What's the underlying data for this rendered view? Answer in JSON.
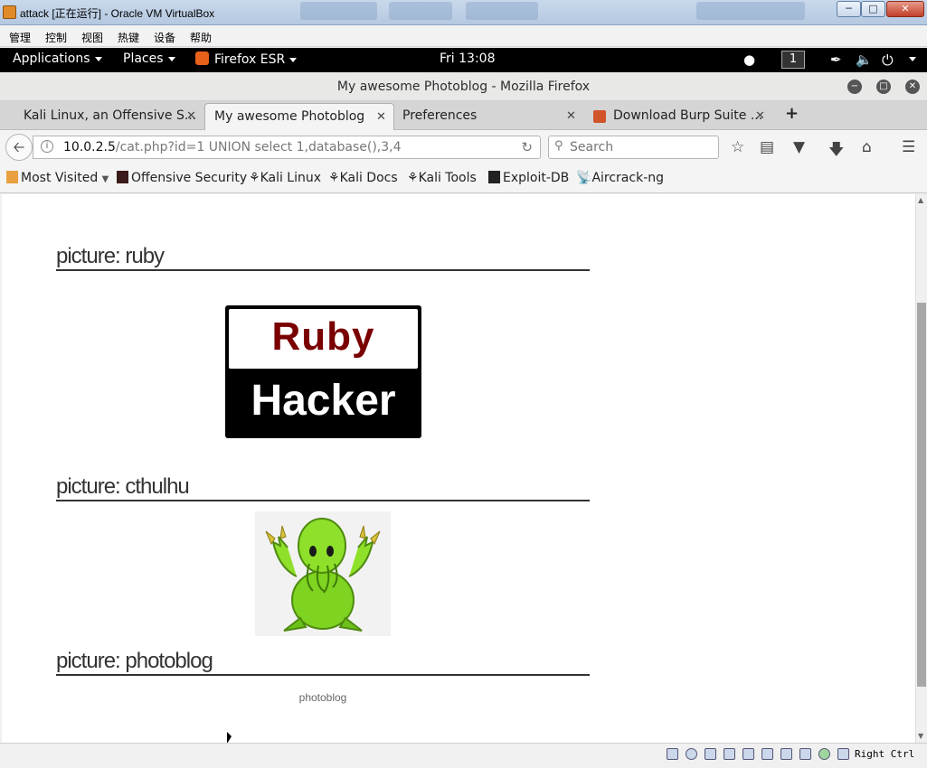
{
  "vbox": {
    "title": "attack [正在运行] - Oracle VM VirtualBox",
    "menu": [
      "管理",
      "控制",
      "视图",
      "热键",
      "设备",
      "帮助"
    ],
    "host_key": "Right Ctrl"
  },
  "kali_panel": {
    "applications": "Applications",
    "places": "Places",
    "firefox": "Firefox ESR",
    "clock": "Fri 13:08",
    "workspace": "1"
  },
  "firefox": {
    "window_title": "My awesome Photoblog - Mozilla Firefox",
    "tabs": [
      {
        "label": "Kali Linux, an Offensive S..."
      },
      {
        "label": "My awesome Photoblog"
      },
      {
        "label": "Preferences"
      },
      {
        "label": "Download Burp Suite ..."
      }
    ],
    "url": {
      "host": "10.0.2.5",
      "path": "/cat.php?id=1 UNION select 1,database(),3,4"
    },
    "search_placeholder": "Search",
    "bookmarks": [
      "Most Visited",
      "Offensive Security",
      "Kali Linux",
      "Kali Docs",
      "Kali Tools",
      "Exploit-DB",
      "Aircrack-ng"
    ]
  },
  "page": {
    "pictures": [
      {
        "title": "picture: ruby"
      },
      {
        "title": "picture: cthulhu"
      },
      {
        "title": "picture: photoblog"
      }
    ],
    "ruby_logo": {
      "line1": "Ruby",
      "line2": "Hacker"
    },
    "photoblog_alt": "photoblog"
  },
  "colors": {
    "ruby_red": "#7a0000",
    "cthulhu_green": "#7fd321"
  }
}
